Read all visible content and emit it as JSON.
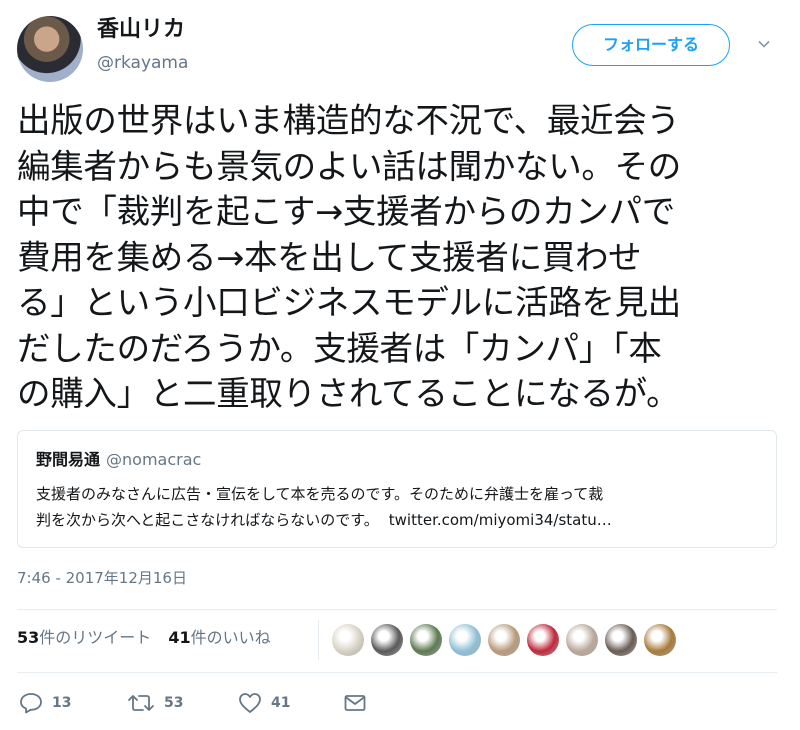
{
  "user": {
    "name": "香山リカ",
    "handle": "@rkayama"
  },
  "follow_button": {
    "label": "フォローする",
    "color": "#1da1f2"
  },
  "tweet": {
    "lines": [
      "出版の世界はいま構造的な不況で、最近会う",
      "編集者からも景気のよい話は聞かない。その",
      "中で「裁判を起こす→支援者からのカンパで",
      "費用を集める→本を出して支援者に買わせ",
      "る」という小口ビジネスモデルに活路を見出",
      "だしたのだろうか。支援者は「カンパ」「本",
      "の購入」と二重取りされてることになるが。"
    ]
  },
  "quote": {
    "name": "野間易通",
    "handle": "@nomacrac",
    "line1": "支援者のみなさんに広告・宣伝をして本を売るのです。そのために弁護士を雇って裁",
    "line2": "判を次から次へと起こさなければならないのです。",
    "link": "twitter.com/miyomi34/statu…"
  },
  "timestamp": "7:46 - 2017年12月16日",
  "stats": {
    "retweets_count": "53",
    "retweets_label": "件のリツイート",
    "likes_count": "41",
    "likes_label": "件のいいね"
  },
  "likers": [
    {
      "color": "#d8d2c4",
      "icon": "avatar"
    },
    {
      "color": "#5a5a5a",
      "icon": "avatar"
    },
    {
      "color": "#5d7a52",
      "icon": "avatar"
    },
    {
      "color": "#8fbfd8",
      "icon": "avatar"
    },
    {
      "color": "#b89a7a",
      "icon": "avatar"
    },
    {
      "color": "#c0283a",
      "icon": "avatar"
    },
    {
      "color": "#b9a89a",
      "icon": "avatar"
    },
    {
      "color": "#6a5d55",
      "icon": "avatar"
    },
    {
      "color": "#a87a3a",
      "icon": "avatar"
    }
  ],
  "actions": {
    "reply_count": "13",
    "retweet_count": "53",
    "like_count": "41"
  }
}
